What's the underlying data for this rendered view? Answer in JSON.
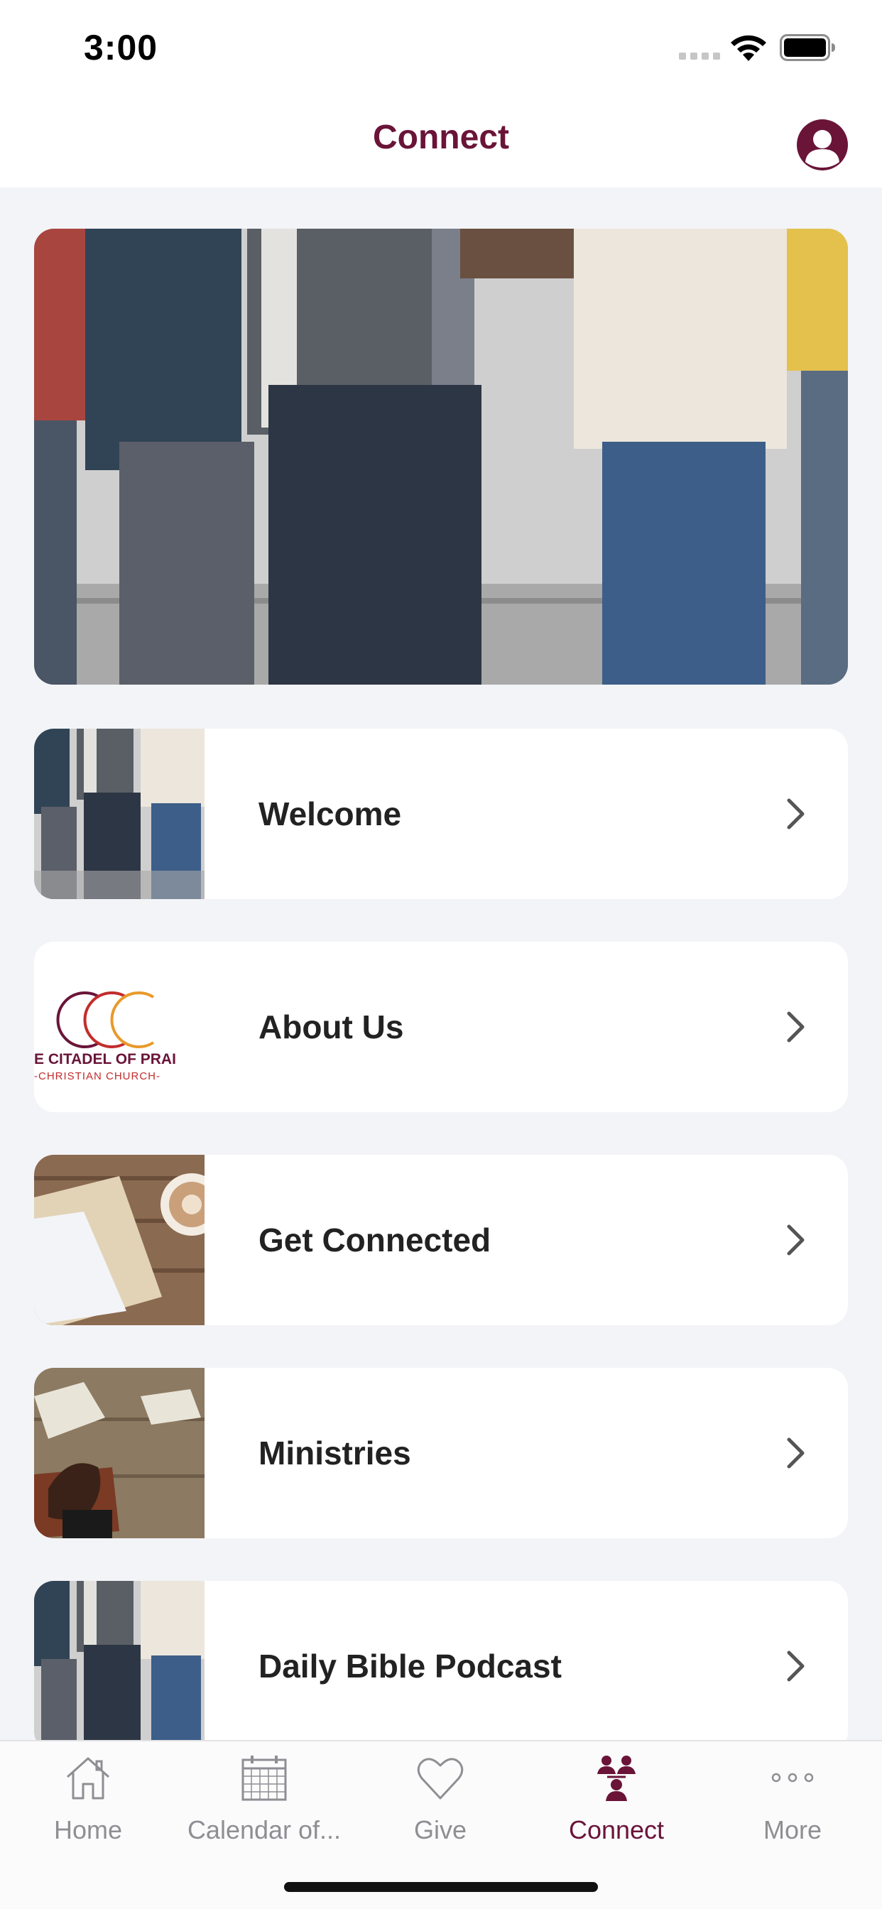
{
  "status_bar": {
    "time": "3:00"
  },
  "nav": {
    "title": "Connect",
    "profile_icon": "person-circle-icon"
  },
  "hero": {
    "image": "people-standing-photo"
  },
  "list_items": [
    {
      "label": "Welcome",
      "thumb": "people-standing-photo"
    },
    {
      "label": "About Us",
      "thumb": "church-logo",
      "logo_text_1": "E CITADEL OF PRAI",
      "logo_text_2": "-CHRISTIAN CHURCH-"
    },
    {
      "label": "Get Connected",
      "thumb": "coffee-notebook-photo"
    },
    {
      "label": "Ministries",
      "thumb": "praying-hands-bible-photo"
    },
    {
      "label": "Daily Bible Podcast",
      "thumb": "people-standing-photo"
    }
  ],
  "tabs": [
    {
      "label": "Home",
      "icon": "house-icon",
      "active": false
    },
    {
      "label": "Calendar of...",
      "icon": "calendar-icon",
      "active": false
    },
    {
      "label": "Give",
      "icon": "heart-icon",
      "active": false
    },
    {
      "label": "Connect",
      "icon": "people-group-icon",
      "active": true
    },
    {
      "label": "More",
      "icon": "more-dots-icon",
      "active": false
    }
  ],
  "colors": {
    "brand": "#6a1438",
    "background": "#f3f4f8",
    "inactive": "#8e8e93"
  }
}
